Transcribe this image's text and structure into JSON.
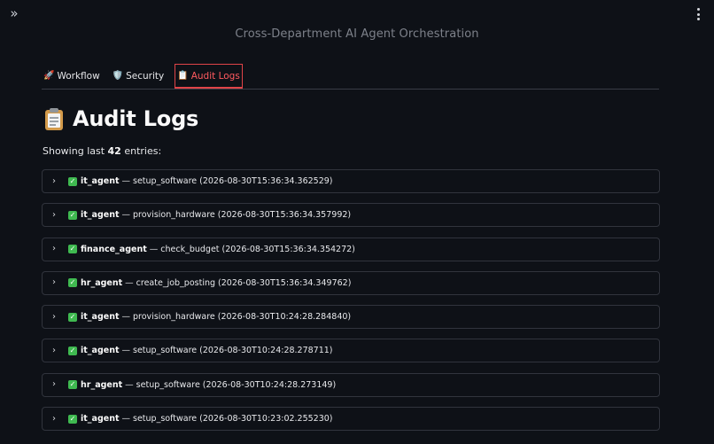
{
  "app": {
    "subtitle": "Cross-Department AI Agent Orchestration",
    "sidebar_toggle_glyph": "»",
    "accent_color": "#ff5a5f"
  },
  "tabs": [
    {
      "label": "Workflow",
      "icon": "rocket-icon",
      "glyph": "🚀",
      "active": false
    },
    {
      "label": "Security",
      "icon": "shield-icon",
      "glyph": "🛡️",
      "active": false
    },
    {
      "label": "Audit Logs",
      "icon": "clipboard-icon",
      "glyph": "📋",
      "active": true
    }
  ],
  "page": {
    "title": "Audit Logs",
    "title_icon": "clipboard-icon",
    "count_prefix": "Showing last",
    "count_value": "42",
    "count_suffix": "entries:"
  },
  "logs": [
    {
      "agent": "it_agent",
      "separator": "—",
      "action": "setup_software",
      "timestamp": "(2026-08-30T15:36:34.362529)",
      "status_icon": "check-icon"
    },
    {
      "agent": "it_agent",
      "separator": "—",
      "action": "provision_hardware",
      "timestamp": "(2026-08-30T15:36:34.357992)",
      "status_icon": "check-icon"
    },
    {
      "agent": "finance_agent",
      "separator": "—",
      "action": "check_budget",
      "timestamp": "(2026-08-30T15:36:34.354272)",
      "status_icon": "check-icon"
    },
    {
      "agent": "hr_agent",
      "separator": "—",
      "action": "create_job_posting",
      "timestamp": "(2026-08-30T15:36:34.349762)",
      "status_icon": "check-icon"
    },
    {
      "agent": "it_agent",
      "separator": "—",
      "action": "provision_hardware",
      "timestamp": "(2026-08-30T10:24:28.284840)",
      "status_icon": "check-icon"
    },
    {
      "agent": "it_agent",
      "separator": "—",
      "action": "setup_software",
      "timestamp": "(2026-08-30T10:24:28.278711)",
      "status_icon": "check-icon"
    },
    {
      "agent": "hr_agent",
      "separator": "—",
      "action": "setup_software",
      "timestamp": "(2026-08-30T10:24:28.273149)",
      "status_icon": "check-icon"
    },
    {
      "agent": "it_agent",
      "separator": "—",
      "action": "setup_software",
      "timestamp": "(2026-08-30T10:23:02.255230)",
      "status_icon": "check-icon"
    }
  ]
}
